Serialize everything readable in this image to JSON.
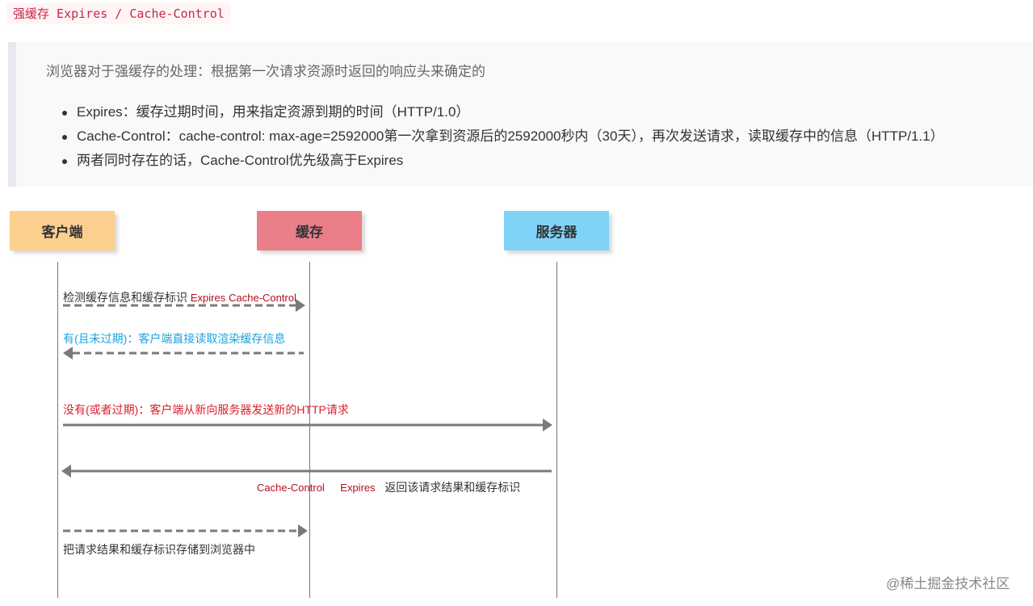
{
  "heading": {
    "prefix": "强缓存",
    "code": " Expires / Cache-Control"
  },
  "quote": {
    "intro": "浏览器对于强缓存的处理：根据第一次请求资源时返回的响应头来确定的",
    "items": [
      "Expires：缓存过期时间，用来指定资源到期的时间（HTTP/1.0）",
      "Cache-Control：cache-control: max-age=2592000第一次拿到资源后的2592000秒内（30天），再次发送请求，读取缓存中的信息（HTTP/1.1）",
      "两者同时存在的话，Cache-Control优先级高于Expires"
    ]
  },
  "diagram": {
    "actors": {
      "client": "客户端",
      "cache": "缓存",
      "server": "服务器"
    },
    "colors": {
      "client": "#fbd08e",
      "cache": "#ea7f8a",
      "server": "#7fd3f7"
    },
    "messages": {
      "check": "检测缓存信息和缓存标识",
      "check_tag1": "Expires",
      "check_tag2": "Cache-Control",
      "hit": "有(且未过期)：客户端直接读取渲染缓存信息",
      "miss": "没有(或者过期)：客户端从新向服务器发送新的HTTP请求",
      "return_tag1": "Cache-Control",
      "return_tag2": "Expires",
      "return_text": "返回该请求结果和缓存标识",
      "store": "把请求结果和缓存标识存储到浏览器中"
    }
  },
  "watermark": "@稀土掘金技术社区"
}
